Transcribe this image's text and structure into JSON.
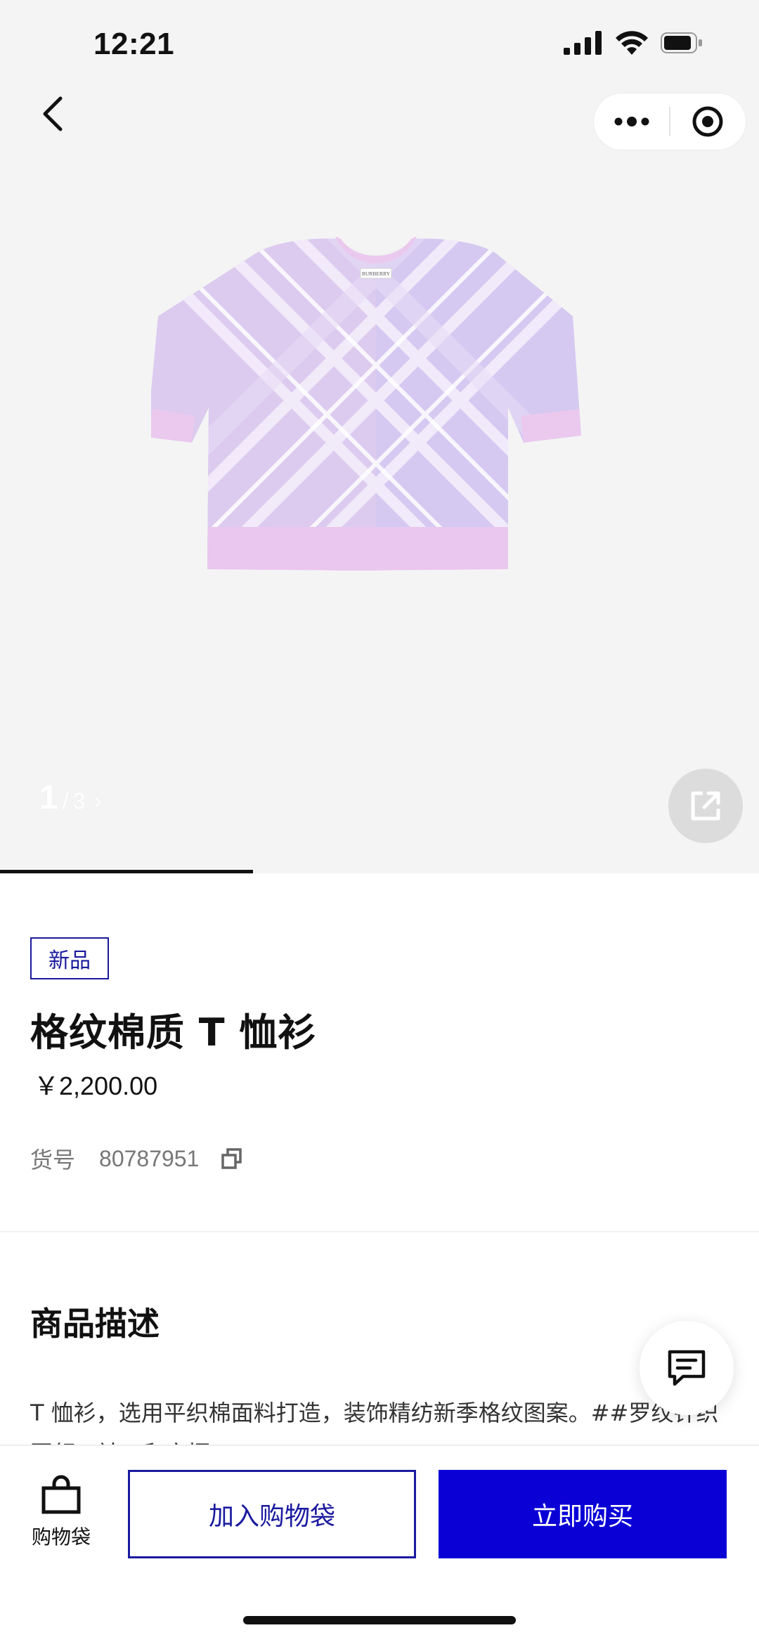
{
  "status_bar": {
    "time": "12:21"
  },
  "gallery": {
    "current": "1",
    "separator": "/",
    "total": "3",
    "progress_fraction": 0.333
  },
  "product": {
    "badge": "新品",
    "title": "格纹棉质 T 恤衫",
    "price": "￥2,200.00",
    "sku_label": "货号",
    "sku_value": "80787951",
    "image_brand_text": "BURBERRY"
  },
  "description": {
    "heading": "商品描述",
    "text": "T 恤衫，选用平织棉面料打造，装饰精纺新季格纹图案。##罗纹针织圆领，袖口和衣摆。"
  },
  "bottom_bar": {
    "bag_label": "购物袋",
    "add_to_bag": "加入购物袋",
    "buy_now": "立即购买"
  },
  "colors": {
    "brand_blue": "#0a00d6",
    "outline_blue": "#1a1aa0",
    "hero_bg": "#f4f4f4",
    "shirt_lavender": "#d9c8ef",
    "shirt_pink": "#e9c6ec"
  },
  "icons": {
    "back": "chevron-left-icon",
    "more": "more-dots-icon",
    "close_target": "target-icon",
    "share": "share-out-icon",
    "copy": "copy-icon",
    "chat": "chat-icon",
    "bag": "shopping-bag-icon"
  }
}
